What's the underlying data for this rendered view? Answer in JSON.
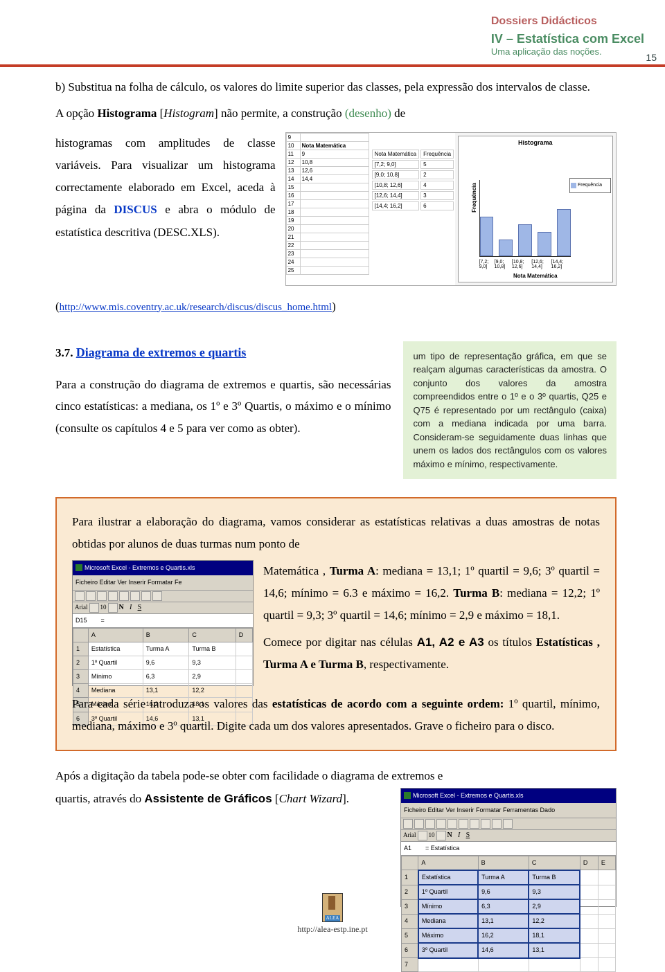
{
  "header": {
    "line1": "Dossiers Didácticos",
    "line2": "IV – Estatística com Excel",
    "line3": "Uma aplicação das noções.",
    "page": "15"
  },
  "top_para1": "b) Substitua na folha de cálculo, os valores do limite superior das classes, pela expressão dos intervalos de classe.",
  "top_para2_a": "A opção ",
  "top_para2_b": "Histograma",
  "top_para2_c": " [",
  "top_para2_d": "Histogram",
  "top_para2_e": "] não permite, a construção ",
  "top_para2_f": "(desenho)",
  "top_para2_g": " de ",
  "narrow1": "histogramas com amplitudes de classe variáveis. Para visualizar um histograma correctamente elaborado em Excel, aceda à página da ",
  "discus": "DISCUS",
  "narrow2": " e abra o módulo de estatística descritiva (DESC.XLS).",
  "link_open": "(",
  "link": "http://www.mis.coventry.ac.uk/research/discus/discus_home.html",
  "link_close": ")",
  "fig_histo": {
    "rowheads": [
      "9",
      "10",
      "11",
      "12",
      "13",
      "14",
      "15",
      "16",
      "17",
      "18",
      "19",
      "20",
      "21",
      "22",
      "23",
      "24",
      "25"
    ],
    "a_vals": [
      "",
      "Nota Matemática",
      "9",
      "10,8",
      "12,6",
      "14,4"
    ],
    "mid_h1": "Nota Matemática",
    "mid_h2": "Frequência",
    "mid_rows": [
      [
        "[7,2; 9,0]",
        "5"
      ],
      [
        "[9,0; 10,8]",
        "2"
      ],
      [
        "[10,8; 12,6]",
        "4"
      ],
      [
        "[12,6; 14,4]",
        "3"
      ],
      [
        "[14,4; 16,2]",
        "6"
      ]
    ],
    "chart_title": "Histograma",
    "legend": "Frequência",
    "ylab": "Frequência",
    "xlab": "Nota Matemática",
    "xticks": [
      "[7,2; 9,0]",
      "[9,0; 10,8]",
      "[10,8; 12,6]",
      "[12,6; 14,4]",
      "[14,4; 16,2]"
    ],
    "bars": [
      50,
      20,
      40,
      30,
      60
    ]
  },
  "chart_data": {
    "type": "bar",
    "title": "Histograma",
    "xlabel": "Nota Matemática",
    "ylabel": "Frequência",
    "categories": [
      "[7,2; 9,0]",
      "[9,0; 10,8]",
      "[10,8; 12,6]",
      "[12,6; 14,4]",
      "[14,4; 16,2]"
    ],
    "values": [
      5,
      2,
      4,
      3,
      6
    ],
    "ylim": [
      0,
      10
    ]
  },
  "sec_head_num": "3.7. ",
  "sec_head": "Diagrama de extremos e quartis",
  "sec_para": "Para a construção do diagrama de extremos e quartis, são necessárias cinco estatísticas: a mediana, os 1º e 3º Quartis, o máximo e o mínimo (consulte os capítulos 4 e 5 para ver como as obter).",
  "greenbox": "um tipo de representação gráfica, em que se realçam algumas características da amostra. O conjunto dos valores da amostra compreendidos entre o 1º e o 3º quartis, Q25 e Q75 é representado por um rectângulo (caixa) com a mediana indicada por uma barra. Consideram-se seguidamente duas linhas que unem os lados dos rectângulos com os valores máximo e mínimo, respectivamente.",
  "orange": {
    "p1": "Para ilustrar a elaboração do diagrama, vamos considerar as estatísticas relativas a duas amostras de notas obtidas por alunos de duas turmas num ponto de",
    "r1a": "Matemática , ",
    "r1b": "Turma A",
    "r1c": ": mediana = 13,1; 1º quartil = 9,6; 3º quartil = 14,6; mínimo = 6.3 e máximo = 16,2. ",
    "r1d": "Turma B",
    "r1e": ": mediana = 12,2; 1º quartil = 9,3; 3º quartil = 14,6; mínimo = 2,9 e máximo = 18,1.",
    "r2a": "Comece por digitar nas células ",
    "r2b": "A1, A2 e A3",
    "r2c": " os títulos ",
    "r2d": "Estatísticas , Turma A e Turma B",
    "r2e": ", respectivamente.",
    "p3a": "Para cada série introduza os valores das ",
    "p3b": "estatísticas de acordo com a seguinte ordem:",
    "p3c": " 1º quartil, mínimo, mediana, máximo e 3º quartil. Digite cada um dos valores apresentados. Grave o ficheiro para o disco."
  },
  "snap1": {
    "title": "Microsoft Excel - Extremos e Quartis.xls",
    "menu": "Ficheiro  Editar  Ver  Inserir  Formatar  Fe",
    "font": "Arial",
    "size": "10",
    "celladdr": "D15",
    "cols": [
      "A",
      "B",
      "C",
      "D"
    ],
    "rows": [
      [
        "1",
        "Estatística",
        "Turma A",
        "Turma B",
        ""
      ],
      [
        "2",
        "1º Quartil",
        "9,6",
        "9,3",
        ""
      ],
      [
        "3",
        "Mínimo",
        "6,3",
        "2,9",
        ""
      ],
      [
        "4",
        "Mediana",
        "13,1",
        "12,2",
        ""
      ],
      [
        "5",
        "Máximo",
        "16,2",
        "18,1",
        ""
      ],
      [
        "6",
        "3º Quartil",
        "14,6",
        "13,1",
        ""
      ]
    ]
  },
  "post1": "Após a digitação da tabela pode-se obter com facilidade o diagrama de extremos e",
  "post2a": "quartis, através do ",
  "post2b": "Assistente de Gráficos",
  "post2c": " [",
  "post2d": "Chart Wizard",
  "post2e": "].",
  "snap2": {
    "title": "Microsoft Excel - Extremos e Quartis.xls",
    "menu": "Ficheiro  Editar  Ver  Inserir  Formatar  Ferramentas  Dado",
    "font": "Arial",
    "size": "10",
    "celladdr": "A1",
    "formula": "= Estatística",
    "cols": [
      "A",
      "B",
      "C",
      "D",
      "E"
    ],
    "rows": [
      [
        "1",
        "Estatística",
        "Turma A",
        "Turma B",
        "",
        ""
      ],
      [
        "2",
        "1º Quartil",
        "9,6",
        "9,3",
        "",
        ""
      ],
      [
        "3",
        "Mínimo",
        "6,3",
        "2,9",
        "",
        ""
      ],
      [
        "4",
        "Mediana",
        "13,1",
        "12,2",
        "",
        ""
      ],
      [
        "5",
        "Máximo",
        "16,2",
        "18,1",
        "",
        ""
      ],
      [
        "6",
        "3º Quartil",
        "14,6",
        "13,1",
        "",
        ""
      ],
      [
        "7",
        "",
        "",
        "",
        "",
        ""
      ]
    ]
  },
  "footer": {
    "label": "ALEA",
    "url": "http://alea-estp.ine.pt"
  }
}
